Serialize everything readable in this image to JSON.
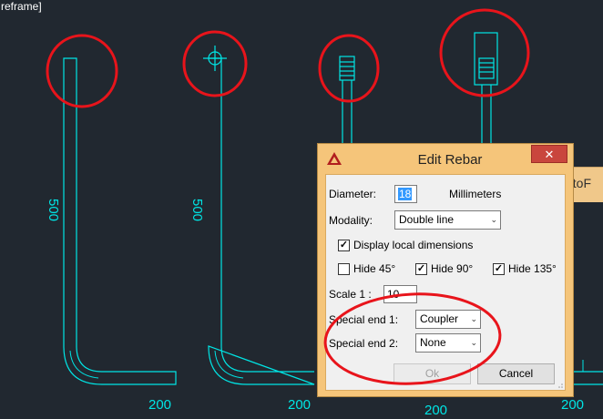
{
  "viewport": {
    "label": "reframe]"
  },
  "drawing": {
    "dim_left_1": "500",
    "dim_left_2": "500",
    "dim_bottom_1": "200",
    "dim_bottom_2": "200",
    "dim_bottom_3": "200",
    "dim_bottom_4": "200",
    "line_color": "#00e5e5",
    "annotation_color": "#e8141b"
  },
  "bg_window": {
    "title_fragment": "utoF"
  },
  "dialog": {
    "title": "Edit Rebar",
    "close_glyph": "✕",
    "diameter_label": "Diameter:",
    "diameter_value": "18",
    "diameter_unit": "Millimeters",
    "modality_label": "Modality:",
    "modality_value": "Double line",
    "display_local_dimensions_label": "Display local dimensions",
    "display_local_dimensions_checked": "✓",
    "hide45_label": "Hide 45°",
    "hide90_label": "Hide 90°",
    "hide90_checked": "✓",
    "hide135_label": "Hide 135°",
    "hide135_checked": "✓",
    "scale_label": "Scale 1 :",
    "scale_value": "10",
    "special_end1_label": "Special end 1:",
    "special_end1_value": "Coupler",
    "special_end2_label": "Special end 2:",
    "special_end2_value": "None",
    "ok_label": "Ok",
    "cancel_label": "Cancel",
    "dropdown_arrow": "⌄",
    "title_color": "#f5c57a"
  }
}
